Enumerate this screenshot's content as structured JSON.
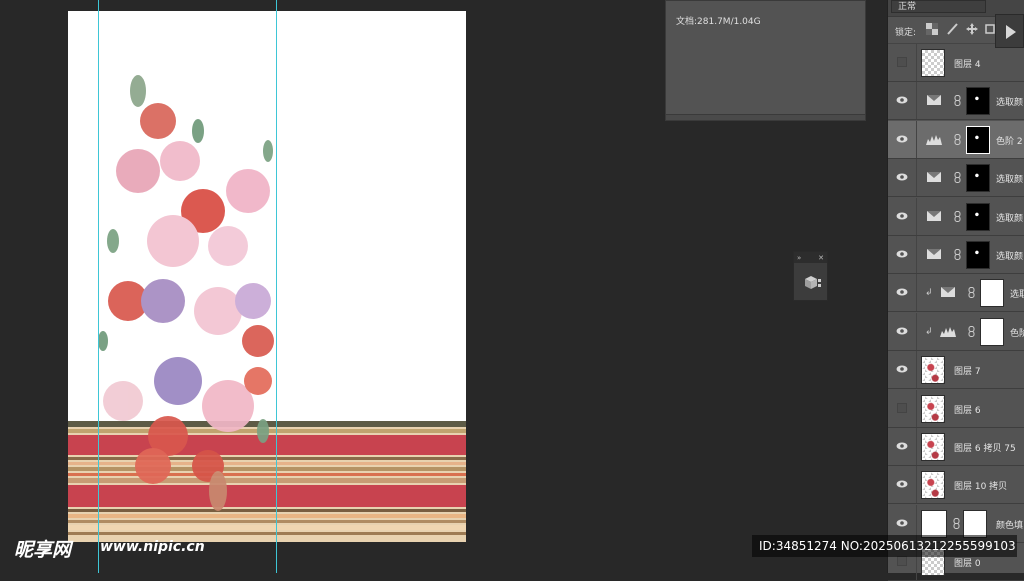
{
  "blend_mode": "正常",
  "lock_label": "锁定:",
  "doc_info": "文档:281.7M/1.04G",
  "layers": [
    {
      "name": "图层 4",
      "visible": false,
      "kind": "pixel"
    },
    {
      "name": "选取颜",
      "visible": true,
      "kind": "selective-color"
    },
    {
      "name": "色阶 2",
      "visible": true,
      "kind": "levels",
      "active": true
    },
    {
      "name": "选取颜",
      "visible": true,
      "kind": "selective-color"
    },
    {
      "name": "选取颜",
      "visible": true,
      "kind": "selective-color"
    },
    {
      "name": "选取颜",
      "visible": true,
      "kind": "selective-color"
    },
    {
      "name": "选取",
      "visible": true,
      "kind": "selective-color-clipped"
    },
    {
      "name": "色阶",
      "visible": true,
      "kind": "levels-clipped"
    },
    {
      "name": "图层 7",
      "visible": true,
      "kind": "pixel"
    },
    {
      "name": "图层 6",
      "visible": false,
      "kind": "pixel"
    },
    {
      "name": "图层 6 拷贝 75",
      "visible": true,
      "kind": "pixel"
    },
    {
      "name": "图层 10 拷贝",
      "visible": true,
      "kind": "pixel"
    },
    {
      "name": "颜色填",
      "visible": true,
      "kind": "fill"
    },
    {
      "name": "图层 0",
      "visible": false,
      "kind": "pixel"
    }
  ],
  "watermark": {
    "logo": "昵享网",
    "url": "www.nipic.cn"
  },
  "id_bar": "ID:34851274 NO:20250613212255599103",
  "colors": {
    "guide": "#3ec6d6",
    "stripe_red": "#c8434f",
    "stripe_tan": "#d8b98e"
  }
}
